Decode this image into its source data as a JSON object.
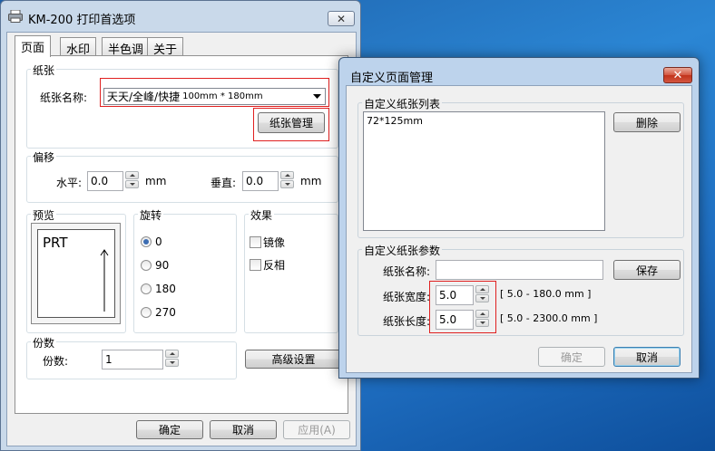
{
  "main": {
    "title": "KM-200 打印首选项",
    "close_glyph": "✕",
    "tabs": [
      "页面",
      "水印",
      "半色调",
      "关于"
    ],
    "paper": {
      "legend": "纸张",
      "name_label": "纸张名称:",
      "selected_name": "天天/全峰/快捷",
      "selected_size": "100mm * 180mm",
      "manage_button": "纸张管理"
    },
    "offset": {
      "legend": "偏移",
      "horizontal_label": "水平:",
      "horizontal_value": "0.0",
      "horizontal_unit": "mm",
      "vertical_label": "垂直:",
      "vertical_value": "0.0",
      "vertical_unit": "mm"
    },
    "preview": {
      "legend": "预览",
      "paper_text": "PRT"
    },
    "rotation": {
      "legend": "旋转",
      "options": [
        "0",
        "90",
        "180",
        "270"
      ],
      "selected": "0"
    },
    "effects": {
      "legend": "效果",
      "mirror_label": "镜像",
      "mirror_checked": false,
      "inverse_label": "反相",
      "inverse_checked": false
    },
    "copies": {
      "legend": "份数",
      "label": "份数:",
      "value": "1"
    },
    "advanced_button": "高级设置",
    "ok_button": "确定",
    "cancel_button": "取消",
    "apply_button": "应用(A)"
  },
  "dialog": {
    "title": "自定义页面管理",
    "close_glyph": "✕",
    "list_legend": "自定义纸张列表",
    "list_items": [
      "72*125mm"
    ],
    "delete_button": "删除",
    "params_legend": "自定义纸张参数",
    "name_label": "纸张名称:",
    "name_value": "",
    "save_button": "保存",
    "width_label": "纸张宽度:",
    "width_value": "5.0",
    "width_range": "[ 5.0 - 180.0 mm ]",
    "length_label": "纸张长度:",
    "length_value": "5.0",
    "length_range": "[ 5.0 - 2300.0 mm ]",
    "ok_button": "确定",
    "cancel_button": "取消"
  },
  "colors": {
    "desktop": "#1f6fc2",
    "highlight_box": "#e02020",
    "radio_selected": "#3d6eb3",
    "dialog_frame": "#bdd3ec",
    "close_red": "#c1331b"
  }
}
